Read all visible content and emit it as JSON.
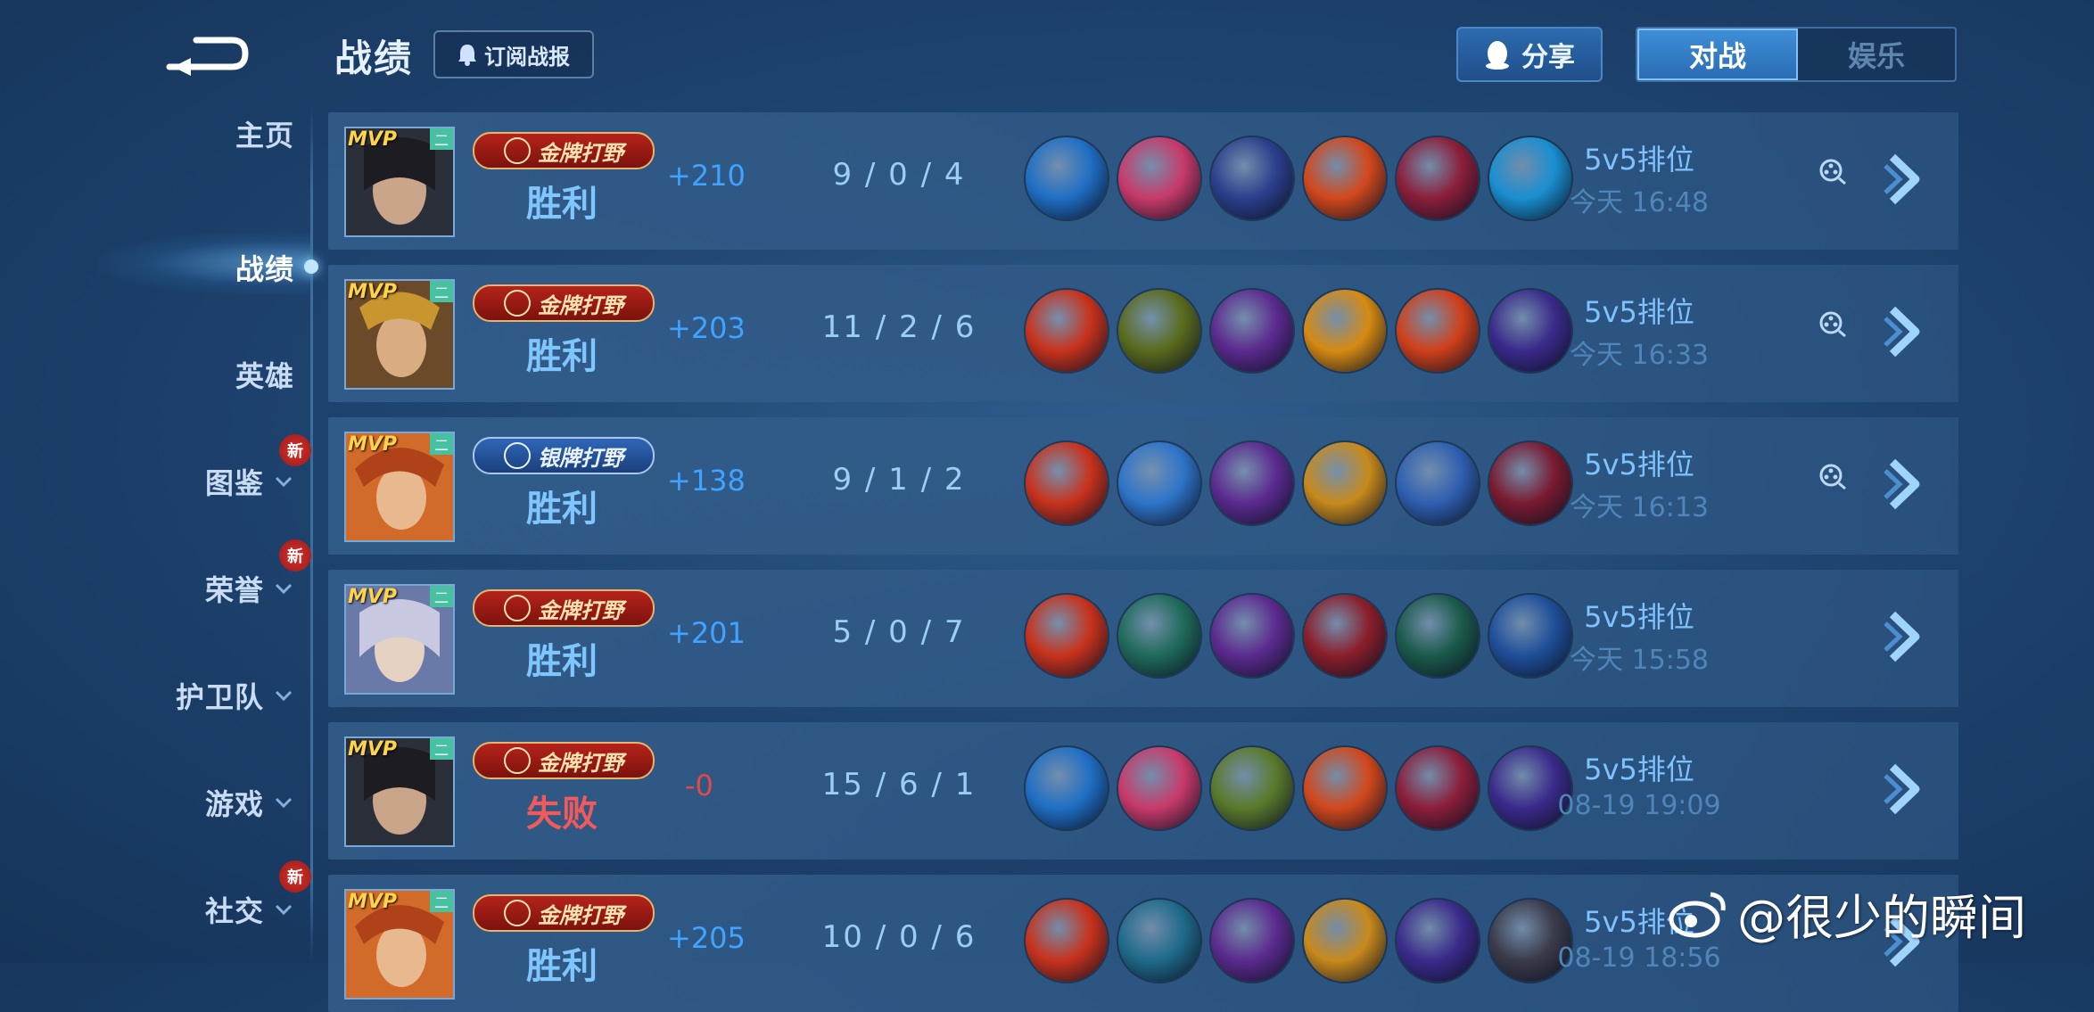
{
  "header": {
    "title": "战绩",
    "subscribe_label": "订阅战报",
    "share_label": "分享",
    "tabs": [
      {
        "label": "对战",
        "active": true
      },
      {
        "label": "娱乐",
        "active": false
      }
    ]
  },
  "sidebar": {
    "items": [
      {
        "label": "主页",
        "chevron": false,
        "badge": "",
        "active": false
      },
      {
        "label": "战绩",
        "chevron": false,
        "badge": "",
        "active": true
      },
      {
        "label": "英雄",
        "chevron": false,
        "badge": "",
        "active": false
      },
      {
        "label": "图鉴",
        "chevron": true,
        "badge": "新",
        "active": false
      },
      {
        "label": "荣誉",
        "chevron": true,
        "badge": "新",
        "active": false
      },
      {
        "label": "护卫队",
        "chevron": true,
        "badge": "",
        "active": false
      },
      {
        "label": "游戏",
        "chevron": true,
        "badge": "",
        "active": false
      },
      {
        "label": "社交",
        "chevron": true,
        "badge": "新",
        "active": false
      }
    ]
  },
  "matches": [
    {
      "mvp": "MVP",
      "rank_mini": "二",
      "badge": "金牌打野",
      "badge_type": "gold",
      "result": "胜利",
      "won": true,
      "score": "+210",
      "kda": "9 / 0 / 4",
      "mode": "5v5排位",
      "time": "今天 16:48",
      "replay": true,
      "items": [
        "#1f6fc4",
        "#c83a6a",
        "#2b3f8c",
        "#d2481c",
        "#8b1e3a",
        "#1a8fd0"
      ]
    },
    {
      "mvp": "MVP",
      "rank_mini": "二",
      "badge": "金牌打野",
      "badge_type": "gold",
      "result": "胜利",
      "won": true,
      "score": "+203",
      "kda": "11 / 2 / 6",
      "mode": "5v5排位",
      "time": "今天 16:33",
      "replay": true,
      "items": [
        "#c8321c",
        "#5a6b1c",
        "#5b2a8e",
        "#d68a12",
        "#d0401a",
        "#3a2a8a"
      ]
    },
    {
      "mvp": "MVP",
      "rank_mini": "二",
      "badge": "银牌打野",
      "badge_type": "silver",
      "result": "胜利",
      "won": true,
      "score": "+138",
      "kda": "9 / 1 / 2",
      "mode": "5v5排位",
      "time": "今天 16:13",
      "replay": true,
      "items": [
        "#c8321c",
        "#2e74c8",
        "#5b2a8e",
        "#c88a1c",
        "#2f5fb0",
        "#7a1a30"
      ]
    },
    {
      "mvp": "MVP",
      "rank_mini": "二",
      "badge": "金牌打野",
      "badge_type": "gold",
      "result": "胜利",
      "won": true,
      "score": "+201",
      "kda": "5 / 0 / 7",
      "mode": "5v5排位",
      "time": "今天 15:58",
      "replay": false,
      "items": [
        "#c8321c",
        "#1f6a5a",
        "#5b2a8e",
        "#8a1e2a",
        "#1a5a4a",
        "#1f4f9a"
      ]
    },
    {
      "mvp": "MVP",
      "rank_mini": "二",
      "badge": "金牌打野",
      "badge_type": "gold",
      "result": "失败",
      "won": false,
      "score": "-0",
      "kda": "15 / 6 / 1",
      "mode": "5v5排位",
      "time": "08-19  19:09",
      "replay": false,
      "items": [
        "#1f6fc4",
        "#c83a6a",
        "#5a7a2a",
        "#d2481c",
        "#8b1e3a",
        "#3a2a8a"
      ]
    },
    {
      "mvp": "MVP",
      "rank_mini": "二",
      "badge": "金牌打野",
      "badge_type": "gold",
      "result": "胜利",
      "won": true,
      "score": "+205",
      "kda": "10 / 0 / 6",
      "mode": "5v5排位",
      "time": "08-19  18:56",
      "replay": false,
      "items": [
        "#c8321c",
        "#1f6a8a",
        "#5b2a8e",
        "#c88a1c",
        "#3a2a8a",
        "#3a3a4a"
      ]
    }
  ],
  "watermark": "@很少的瞬间",
  "colors": {
    "win": "#7fc6ff",
    "lose": "#f05a5a",
    "score_pos": "#3fa3ff",
    "score_zero": "#e04a4a"
  }
}
